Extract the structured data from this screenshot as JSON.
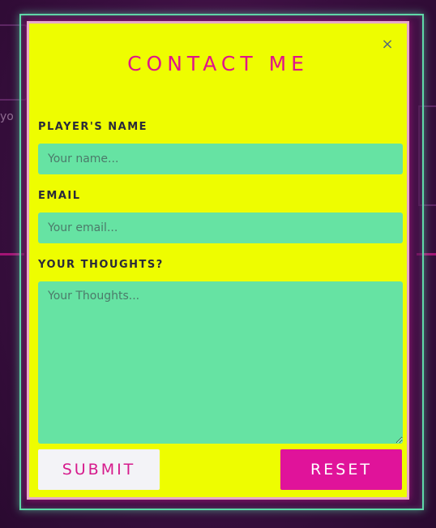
{
  "background": {
    "partial_text": "yo"
  },
  "modal": {
    "title": "CONTACT ME",
    "close_glyph": "×",
    "fields": {
      "name": {
        "label": "PLAYER'S NAME",
        "placeholder": "Your name...",
        "value": ""
      },
      "email": {
        "label": "EMAIL",
        "placeholder": "Your email...",
        "value": ""
      },
      "thoughts": {
        "label": "YOUR THOUGHTS?",
        "placeholder": "Your Thoughts...",
        "value": ""
      }
    },
    "buttons": {
      "submit": "SUBMIT",
      "reset": "RESET"
    }
  },
  "colors": {
    "modal_bg": "#eefd00",
    "title": "#e0158a",
    "input_bg": "#66e3a3",
    "reset_bg": "#e0139a",
    "frame_glow": "#5fd9a8"
  },
  "icons": {
    "close": "close-icon"
  }
}
